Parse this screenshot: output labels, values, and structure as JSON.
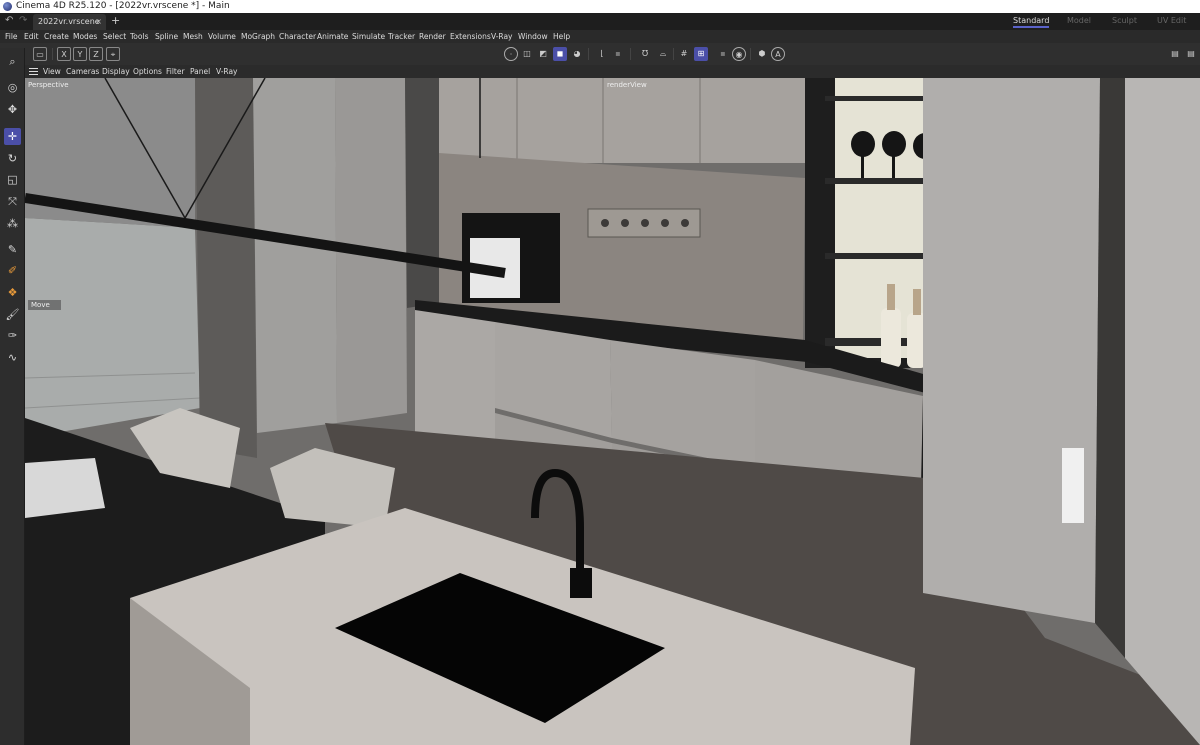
{
  "window": {
    "title": "Cinema 4D R25.120 - [2022vr.vrscene *] - Main"
  },
  "tabs": {
    "document_tab": "2022vr.vrscene *",
    "close_glyph": "×",
    "add_glyph": "+",
    "layouts": [
      "Standard",
      "Model",
      "Sculpt",
      "UV Edit"
    ],
    "active_layout": "Standard"
  },
  "menu": [
    "File",
    "Edit",
    "Create",
    "Modes",
    "Select",
    "Tools",
    "Spline",
    "Mesh",
    "Volume",
    "MoGraph",
    "Character",
    "Animate",
    "Simulate",
    "Tracker",
    "Render",
    "Extensions",
    "V-Ray",
    "Window",
    "Help"
  ],
  "toolbar": {
    "axis_labels": [
      "X",
      "Y",
      "Z"
    ]
  },
  "viewport_menu": [
    "View",
    "Cameras",
    "Display",
    "Options",
    "Filter",
    "Panel",
    "V-Ray"
  ],
  "viewport": {
    "camera_label": "Perspective",
    "render_label": "renderView",
    "tool_label": "Move"
  },
  "colors": {
    "accent": "#4b4fa8",
    "titlebar": "#ffffff",
    "ui_background": "#2b2b2b"
  }
}
